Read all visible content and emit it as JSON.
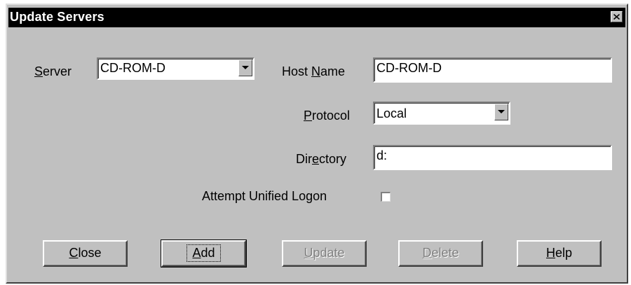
{
  "window": {
    "title": "Update Servers"
  },
  "form": {
    "server": {
      "label_mnemonic": "S",
      "label_rest": "erver",
      "value": "CD-ROM-D"
    },
    "host_name": {
      "label_pre": "Host ",
      "label_mnemonic": "N",
      "label_rest": "ame",
      "value": "CD-ROM-D"
    },
    "protocol": {
      "label_mnemonic": "P",
      "label_rest": "rotocol",
      "value": "Local"
    },
    "directory": {
      "label_pre": "Dir",
      "label_mnemonic": "e",
      "label_rest": "ctory",
      "value": "d:"
    },
    "unified_logon": {
      "label": "Attempt Unified Logon",
      "checked": false
    }
  },
  "buttons": {
    "close": {
      "mnemonic": "C",
      "rest": "lose",
      "enabled": true
    },
    "add": {
      "mnemonic": "A",
      "rest": "dd",
      "enabled": true,
      "default": true
    },
    "update": {
      "mnemonic": "U",
      "rest": "pdate",
      "enabled": false
    },
    "delete": {
      "mnemonic": "D",
      "rest": "elete",
      "enabled": false
    },
    "help": {
      "mnemonic": "H",
      "rest": "elp",
      "enabled": true
    }
  },
  "icons": {
    "close": "close-icon",
    "dropdown": "chevron-down-icon"
  }
}
